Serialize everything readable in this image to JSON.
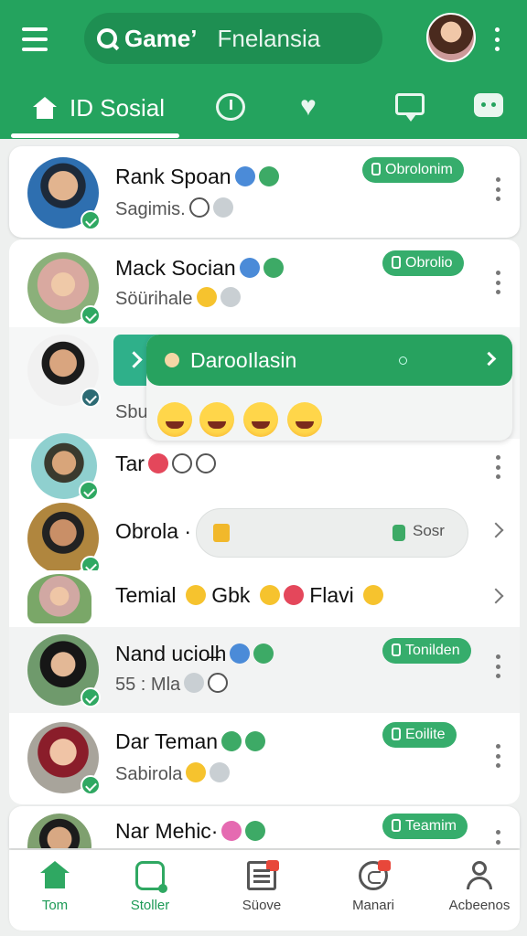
{
  "header": {
    "brand": "Game’",
    "search_placeholder": "Fnelansia",
    "active_tab": "ID Sosial",
    "tab_icons": [
      "timer-icon",
      "heart-icon",
      "chat-icon",
      "game-icon"
    ]
  },
  "chats": [
    {
      "name": "Rank Spoan",
      "sub": "Sagimis.",
      "badge": "Obrolonim"
    },
    {
      "name": "Mack Socian",
      "sub": "Söürihale",
      "badge": "Obrolio"
    },
    {
      "name": "",
      "sub": "Sbu",
      "badge": ""
    },
    {
      "name": "Tar",
      "sub": "",
      "badge": ""
    },
    {
      "name": "Obrola ·",
      "sub": "",
      "badge": ""
    },
    {
      "name": "Temial",
      "sub": "",
      "badge": ""
    },
    {
      "name": "Nand uciol̶h",
      "sub": "55 : Mla",
      "badge": "Tonilden"
    },
    {
      "name": "Dar Teman",
      "sub": "Sabirola",
      "badge": "Eoilite"
    },
    {
      "name": "Nar Mehic·",
      "sub": "",
      "badge": "Teamim"
    }
  ],
  "temial_extra": {
    "text1": "Gbk",
    "text2": "Flavi"
  },
  "popup": {
    "title": "DarooIlasin"
  },
  "inline_pill": {
    "label": "Sosr"
  },
  "bottom_nav": [
    {
      "label": "Tom"
    },
    {
      "label": "Stoller"
    },
    {
      "label": "Süove"
    },
    {
      "label": "Manari"
    },
    {
      "label": "Acbeenos"
    }
  ],
  "colors": {
    "primary": "#24a35e",
    "badge": "#36ad6c",
    "background": "#eef0ef"
  }
}
